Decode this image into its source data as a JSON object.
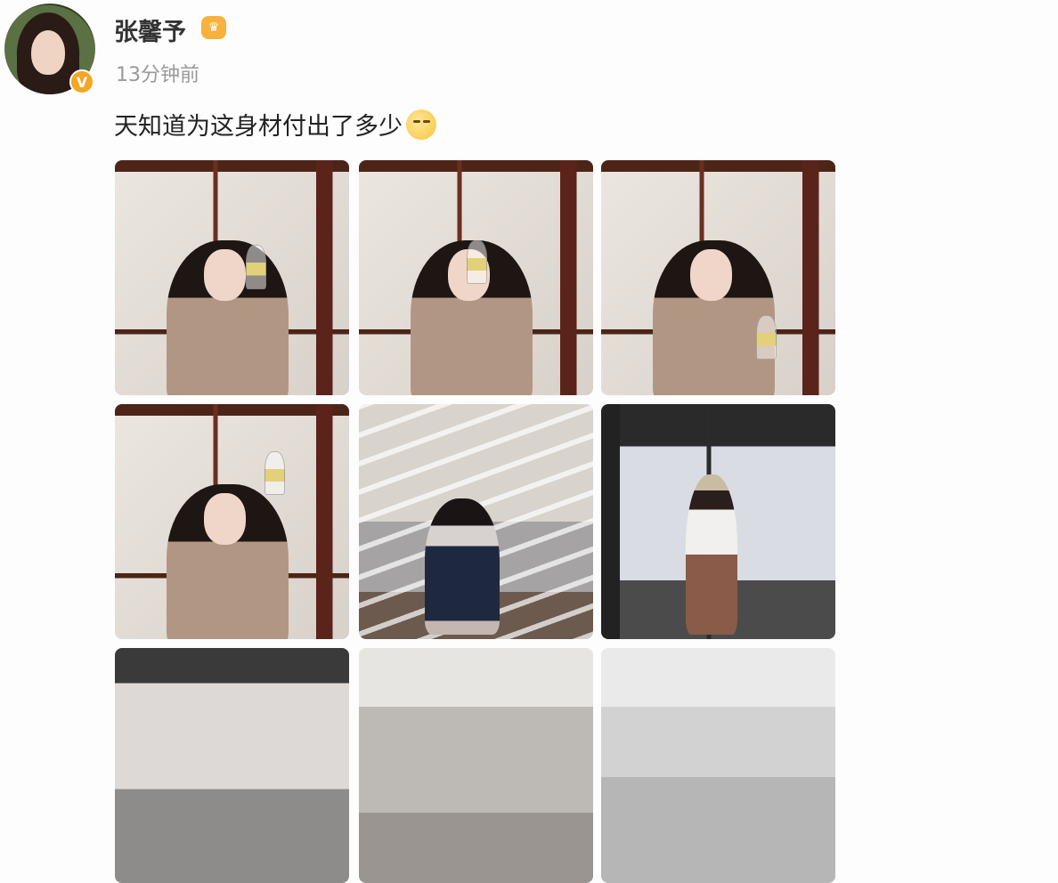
{
  "post": {
    "username": "张馨予",
    "time": "13分钟前",
    "text": "天知道为这身材付出了多少",
    "emoji": "smirk-emoji",
    "verified_badge": "V"
  },
  "photos": [
    {
      "name": "photo-1",
      "scene": "indoor-wine"
    },
    {
      "name": "photo-2",
      "scene": "indoor-wine"
    },
    {
      "name": "photo-3",
      "scene": "indoor-wine"
    },
    {
      "name": "photo-4",
      "scene": "indoor-wine"
    },
    {
      "name": "photo-5",
      "scene": "garage"
    },
    {
      "name": "photo-6",
      "scene": "gym"
    },
    {
      "name": "photo-7",
      "scene": "gym"
    },
    {
      "name": "photo-8",
      "scene": "gym"
    },
    {
      "name": "photo-9",
      "scene": "gym"
    }
  ]
}
